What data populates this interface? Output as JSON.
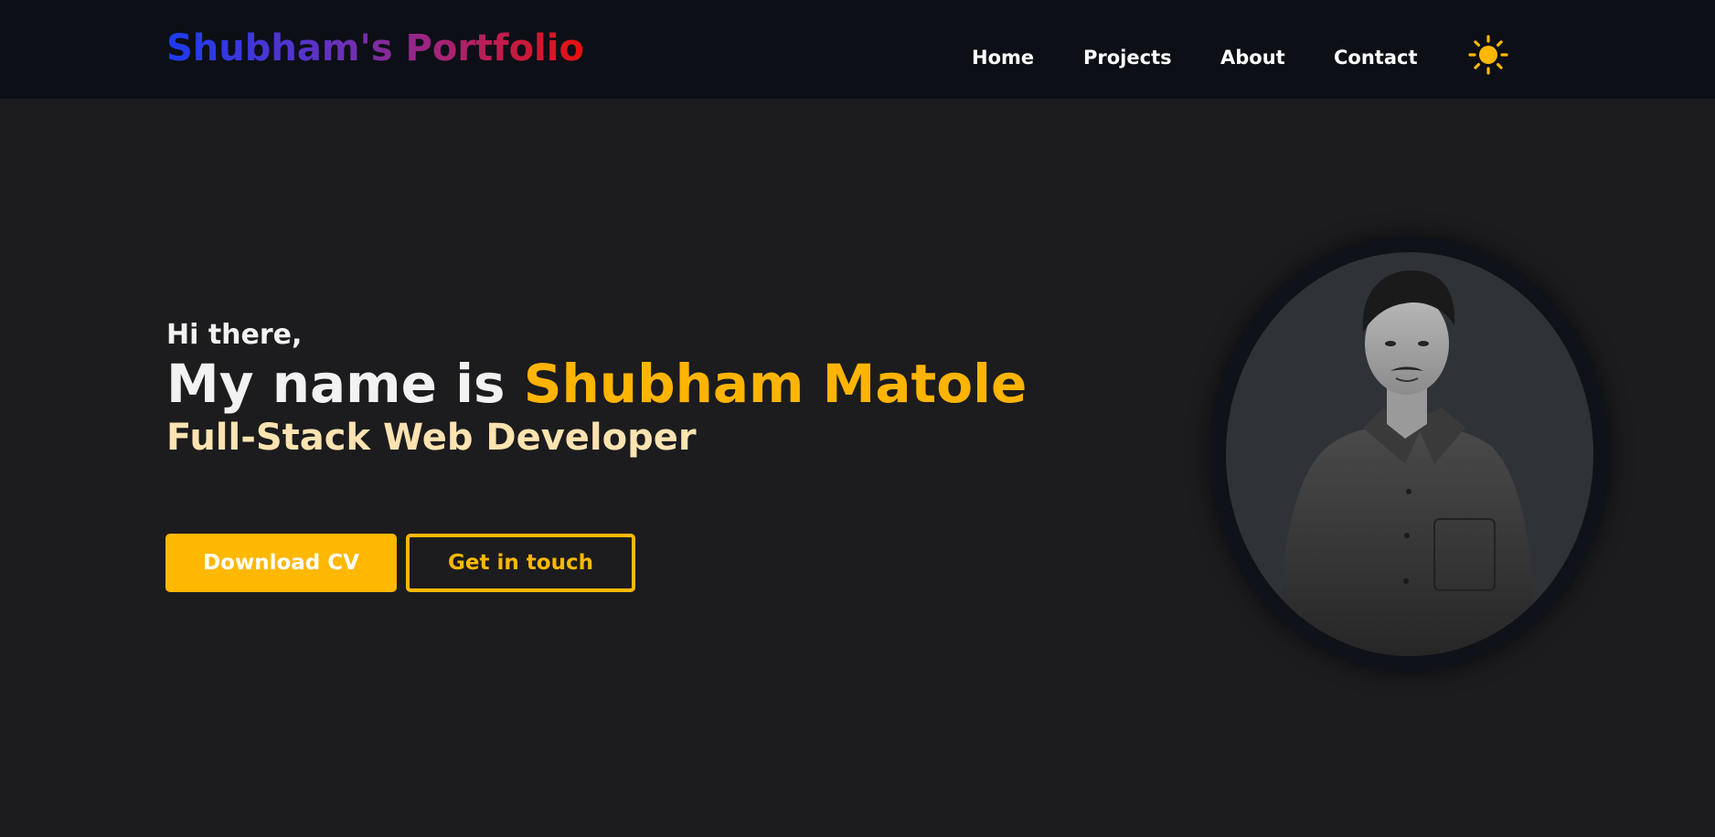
{
  "navbar": {
    "brand": "Shubham's Portfolio",
    "links": [
      {
        "label": "Home"
      },
      {
        "label": "Projects"
      },
      {
        "label": "About"
      },
      {
        "label": "Contact"
      }
    ],
    "theme_toggle_icon": "sun-icon"
  },
  "hero": {
    "greeting": "Hi there,",
    "headline_prefix": "My name is ",
    "headline_name": "Shubham Matole",
    "subtitle": "Full-Stack Web Developer",
    "buttons": {
      "download_cv": "Download CV",
      "get_in_touch": "Get in touch"
    },
    "avatar_icon": "portrait-photo"
  },
  "colors": {
    "background": "#1c1c1e",
    "navbar": "#0d0f17",
    "accent": "#ffb800",
    "subtitle": "#fde3b0",
    "brand_gradient": [
      "#1b3cf2",
      "#e8110f"
    ]
  }
}
